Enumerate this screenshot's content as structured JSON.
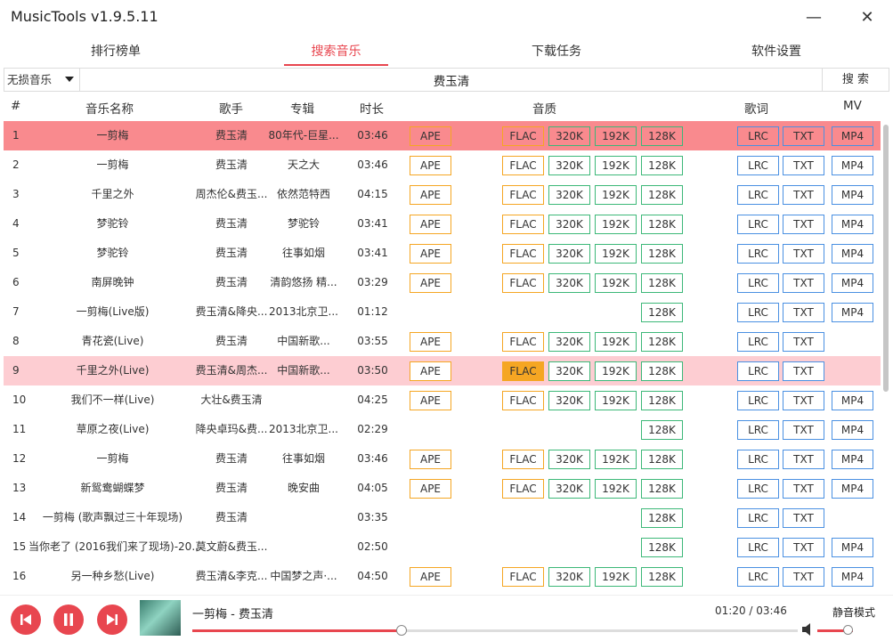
{
  "window": {
    "title": "MusicTools v1.9.5.11",
    "minimize": "—",
    "close": "✕"
  },
  "tabs": [
    "排行榜单",
    "搜索音乐",
    "下载任务",
    "软件设置"
  ],
  "search": {
    "quality": "无损音乐",
    "query": "费玉清",
    "button": "搜 索"
  },
  "headers": {
    "num": "#",
    "name": "音乐名称",
    "artist": "歌手",
    "album": "专辑",
    "duration": "时长",
    "quality": "音质",
    "lyrics": "歌词",
    "mv": "MV"
  },
  "labels": {
    "ape": "APE",
    "flac": "FLAC",
    "q320": "320K",
    "q192": "192K",
    "q128": "128K",
    "lrc": "LRC",
    "txt": "TXT",
    "mp4": "MP4"
  },
  "rows": [
    {
      "num": "1",
      "name": "一剪梅",
      "artist": "费玉清",
      "album": "80年代-巨星...",
      "duration": "03:46",
      "state": "selected"
    },
    {
      "num": "2",
      "name": "一剪梅",
      "artist": "费玉清",
      "album": "天之大",
      "duration": "03:46"
    },
    {
      "num": "3",
      "name": "千里之外",
      "artist": "周杰伦&费玉...",
      "album": "依然范特西",
      "duration": "04:15"
    },
    {
      "num": "4",
      "name": "梦驼铃",
      "artist": "费玉清",
      "album": "梦驼铃",
      "duration": "03:41"
    },
    {
      "num": "5",
      "name": "梦驼铃",
      "artist": "费玉清",
      "album": "往事如烟",
      "duration": "03:41"
    },
    {
      "num": "6",
      "name": "南屏晚钟",
      "artist": "费玉清",
      "album": "清韵悠扬 精...",
      "duration": "03:29"
    },
    {
      "num": "7",
      "name": "一剪梅(Live版)",
      "artist": "费玉清&降央...",
      "album": "2013北京卫...",
      "duration": "01:12"
    },
    {
      "num": "8",
      "name": "青花瓷(Live)",
      "artist": "费玉清",
      "album": "中国新歌...",
      "duration": "03:55"
    },
    {
      "num": "9",
      "name": "千里之外(Live)",
      "artist": "费玉清&周杰...",
      "album": "中国新歌...",
      "duration": "03:50",
      "state": "highlight"
    },
    {
      "num": "10",
      "name": "我们不一样(Live)",
      "artist": "大壮&费玉清",
      "album": "",
      "duration": "04:25"
    },
    {
      "num": "11",
      "name": "草原之夜(Live)",
      "artist": "降央卓玛&费...",
      "album": "2013北京卫...",
      "duration": "02:29"
    },
    {
      "num": "12",
      "name": "一剪梅",
      "artist": "费玉清",
      "album": "往事如烟",
      "duration": "03:46"
    },
    {
      "num": "13",
      "name": "新鸳鸯蝴蝶梦",
      "artist": "费玉清",
      "album": "晚安曲",
      "duration": "04:05"
    },
    {
      "num": "14",
      "name": "一剪梅 (歌声飘过三十年现场)",
      "artist": "费玉清",
      "album": "",
      "duration": "03:35"
    },
    {
      "num": "15",
      "name": "当你老了 (2016我们来了现场)-20...",
      "artist": "莫文蔚&费玉...",
      "album": "",
      "duration": "02:50"
    },
    {
      "num": "16",
      "name": "另一种乡愁(Live)",
      "artist": "费玉清&李克...",
      "album": "中国梦之声·...",
      "duration": "04:50"
    }
  ],
  "player": {
    "track": "一剪梅 - 费玉清",
    "time": "01:20 / 03:46",
    "lyric_search": "静音模式",
    "progress_fraction": 0.345,
    "volume_fraction": 0.85
  },
  "colors": {
    "accent": "#e8464f",
    "selected_row": "#f98a8e",
    "highlight_row": "#fdcdd2",
    "orange": "#f5a623",
    "green": "#3cb878",
    "blue": "#4a90e2"
  }
}
